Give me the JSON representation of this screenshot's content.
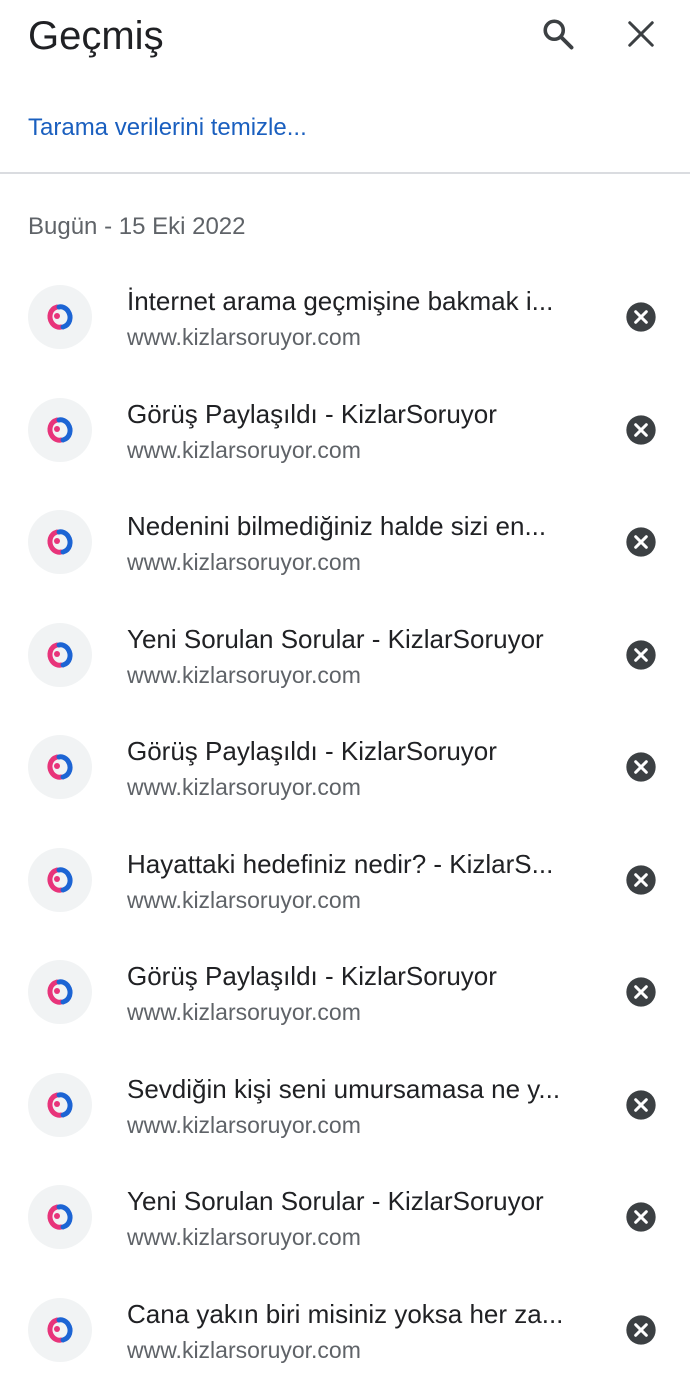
{
  "header": {
    "title": "Geçmiş",
    "search_icon": "search-icon",
    "close_icon": "close-icon"
  },
  "clear_link": "Tarama verilerini temizle...",
  "section": {
    "date_label": "Bugün - 15 Eki 2022"
  },
  "colors": {
    "accent": "#1a5fbf",
    "favicon_pink": "#e8347a",
    "favicon_blue": "#1c64d4",
    "remove_icon": "#3c4043"
  },
  "history": [
    {
      "title": "İnternet arama geçmişine bakmak i...",
      "url": "www.kizlarsoruyor.com"
    },
    {
      "title": "Görüş Paylaşıldı - KizlarSoruyor",
      "url": "www.kizlarsoruyor.com"
    },
    {
      "title": "Nedenini bilmediğiniz halde sizi en...",
      "url": "www.kizlarsoruyor.com"
    },
    {
      "title": "Yeni Sorulan Sorular - KizlarSoruyor",
      "url": "www.kizlarsoruyor.com"
    },
    {
      "title": "Görüş Paylaşıldı - KizlarSoruyor",
      "url": "www.kizlarsoruyor.com"
    },
    {
      "title": "Hayattaki hedefiniz nedir? - KizlarS...",
      "url": "www.kizlarsoruyor.com"
    },
    {
      "title": "Görüş Paylaşıldı - KizlarSoruyor",
      "url": "www.kizlarsoruyor.com"
    },
    {
      "title": "Sevdiğin kişi seni umursamasa ne y...",
      "url": "www.kizlarsoruyor.com"
    },
    {
      "title": "Yeni Sorulan Sorular - KizlarSoruyor",
      "url": "www.kizlarsoruyor.com"
    },
    {
      "title": "Cana yakın biri misiniz yoksa her za...",
      "url": "www.kizlarsoruyor.com"
    }
  ]
}
